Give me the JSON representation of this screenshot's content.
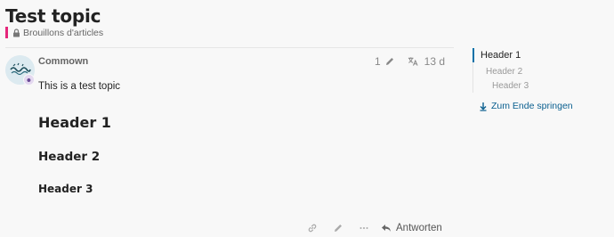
{
  "topic": {
    "title": "Test topic",
    "category": "Brouillons d'articles",
    "category_color": "#e5267a"
  },
  "post": {
    "username": "Commown",
    "edit_count": "1",
    "age": "13 d",
    "body_text": "This is a test topic",
    "header1": "Header 1",
    "header2": "Header 2",
    "header3": "Header 3",
    "icons": {
      "edit": "pencil-icon",
      "translate": "translate-icon",
      "link": "link-icon",
      "more": "more-icon",
      "reply": "reply-icon"
    }
  },
  "actions": {
    "reply_label": "Antworten"
  },
  "toc": {
    "items": [
      "Header 1",
      "Header 2",
      "Header 3"
    ],
    "jump_label": "Zum Ende springen",
    "accent": "#0a71a8"
  }
}
